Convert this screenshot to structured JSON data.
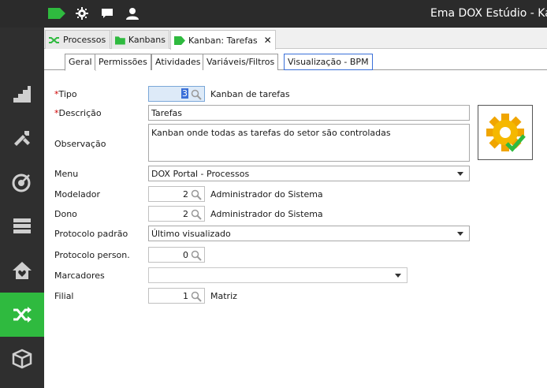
{
  "app_title": "Ema DOX Estúdio - Ka",
  "icons": {
    "tag": "tag-icon",
    "gear": "gear-icon",
    "chat": "chat-icon",
    "user": "user-icon",
    "sidebar": [
      "stairs-icon",
      "tools-icon",
      "target-icon",
      "server-icon",
      "home-heart-icon",
      "shuffle-icon",
      "package-icon"
    ]
  },
  "colors": {
    "accent": "#2fba3f",
    "topbar": "#2b2b2b",
    "sidebar": "#2f2f2f",
    "required": "#d00000"
  },
  "window_tabs": [
    {
      "label": "Processos"
    },
    {
      "label": "Kanbans"
    },
    {
      "label": "Kanban: Tarefas",
      "close": "✕"
    }
  ],
  "form_tabs": [
    "Geral",
    "Permissões",
    "Atividades",
    "Variáveis/Filtros",
    "Visualização - BPM"
  ],
  "form": {
    "required_mark": "*",
    "tipo": {
      "label": "Tipo",
      "value": "3",
      "description": "Kanban de tarefas"
    },
    "descricao": {
      "label": "Descrição",
      "value": "Tarefas"
    },
    "observacao": {
      "label": "Observação",
      "value": "Kanban onde todas as tarefas do setor são controladas"
    },
    "menu": {
      "label": "Menu",
      "value": "DOX Portal - Processos"
    },
    "modelador": {
      "label": "Modelador",
      "value": "2",
      "description": "Administrador do Sistema"
    },
    "dono": {
      "label": "Dono",
      "value": "2",
      "description": "Administrador do Sistema"
    },
    "protocolo_padrao": {
      "label": "Protocolo padrão",
      "value": "Último visualizado"
    },
    "protocolo_person": {
      "label": "Protocolo person.",
      "value": "0"
    },
    "marcadores": {
      "label": "Marcadores",
      "value": ""
    },
    "filial": {
      "label": "Filial",
      "value": "1",
      "description": "Matriz"
    }
  }
}
